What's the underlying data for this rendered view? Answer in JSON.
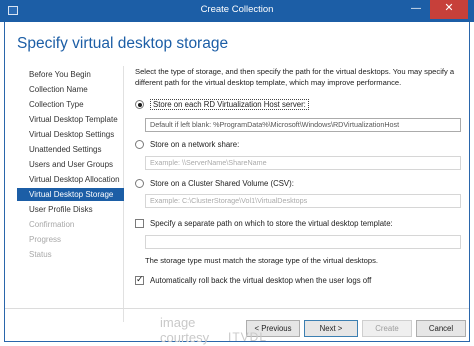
{
  "window": {
    "title": "Create Collection",
    "min_glyph": "—",
    "max_glyph": "□",
    "close_glyph": "✕"
  },
  "page_title": "Specify virtual desktop storage",
  "nav": {
    "items": [
      {
        "label": "Before You Begin",
        "state": "normal"
      },
      {
        "label": "Collection Name",
        "state": "normal"
      },
      {
        "label": "Collection Type",
        "state": "normal"
      },
      {
        "label": "Virtual Desktop Template",
        "state": "normal"
      },
      {
        "label": "Virtual Desktop Settings",
        "state": "normal"
      },
      {
        "label": "Unattended Settings",
        "state": "normal"
      },
      {
        "label": "Users and User Groups",
        "state": "normal"
      },
      {
        "label": "Virtual Desktop Allocation",
        "state": "normal"
      },
      {
        "label": "Virtual Desktop Storage",
        "state": "active"
      },
      {
        "label": "User Profile Disks",
        "state": "normal"
      },
      {
        "label": "Confirmation",
        "state": "disabled"
      },
      {
        "label": "Progress",
        "state": "disabled"
      },
      {
        "label": "Status",
        "state": "disabled"
      }
    ]
  },
  "content": {
    "description": "Select the type of storage, and then specify the path for the virtual desktops. You may specify a different path for the virtual desktop template, which may improve performance.",
    "options": {
      "local": {
        "label": "Store on each RD Virtualization Host server:",
        "checked": true,
        "value": "Default if left blank: %ProgramData%\\Microsoft\\Windows\\RDVirtualizationHost"
      },
      "share": {
        "label": "Store on a network share:",
        "checked": false,
        "placeholder": "Example: \\\\ServerName\\ShareName"
      },
      "csv": {
        "label": "Store on a Cluster Shared Volume (CSV):",
        "checked": false,
        "placeholder": "Example: C:\\ClusterStorage\\Vol1\\VirtualDesktops"
      }
    },
    "separate_path": {
      "label": "Specify a separate path on which to store the virtual desktop template:",
      "checked": false,
      "value": ""
    },
    "storage_note": "The storage type must match the storage type of the virtual desktops.",
    "rollback": {
      "label": "Automatically roll back the virtual desktop when the user logs off",
      "checked": true
    }
  },
  "buttons": {
    "previous": "< Previous",
    "next": "Next >",
    "create": "Create",
    "cancel": "Cancel"
  },
  "watermark": {
    "line1": "image",
    "line2": "courtesy",
    "brand": "ITVDL"
  }
}
